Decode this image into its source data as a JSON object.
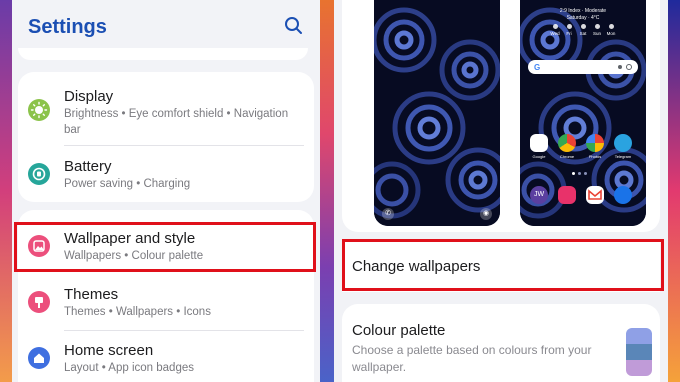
{
  "settings": {
    "title": "Settings",
    "items": [
      {
        "title": "Display",
        "subtitle": "Brightness  •  Eye comfort shield  •  Navigation bar",
        "icon": "sun-icon",
        "color": "#8bc34a"
      },
      {
        "title": "Battery",
        "subtitle": "Power saving  •  Charging",
        "icon": "battery-icon",
        "color": "#26a69a"
      },
      {
        "title": "Wallpaper and style",
        "subtitle": "Wallpapers  •  Colour palette",
        "icon": "image-icon",
        "color": "#ec4f7c"
      },
      {
        "title": "Themes",
        "subtitle": "Themes  •  Wallpapers  •  Icons",
        "icon": "theme-brush-icon",
        "color": "#ec4f7c"
      },
      {
        "title": "Home screen",
        "subtitle": "Layout  •  App icon badges",
        "icon": "home-icon",
        "color": "#3f6fe0"
      }
    ]
  },
  "wallpaper_panel": {
    "lock_preview": {
      "icon_left": "phone-icon",
      "icon_right": "camera-icon"
    },
    "home_preview": {
      "time_line": "2:9 Index · Moderate",
      "date_line": "Saturday · 4°C",
      "weather_days": [
        "Wed",
        "Fri",
        "Sat",
        "Sun",
        "Mon"
      ],
      "apps_row1": [
        "Google",
        "Chrome",
        "Photos",
        "Telegram"
      ],
      "apps_row2": [
        "JW Library",
        "Camera",
        "Gmail",
        "Messages"
      ]
    },
    "change_wallpapers": "Change wallpapers",
    "colour_palette": {
      "title": "Colour palette",
      "description": "Choose a palette based on colours from your wallpaper.",
      "swatch_colors": [
        "#8fa0e6",
        "#5a86b8",
        "#c09bd8"
      ]
    }
  },
  "highlight_color": "#e0101a"
}
